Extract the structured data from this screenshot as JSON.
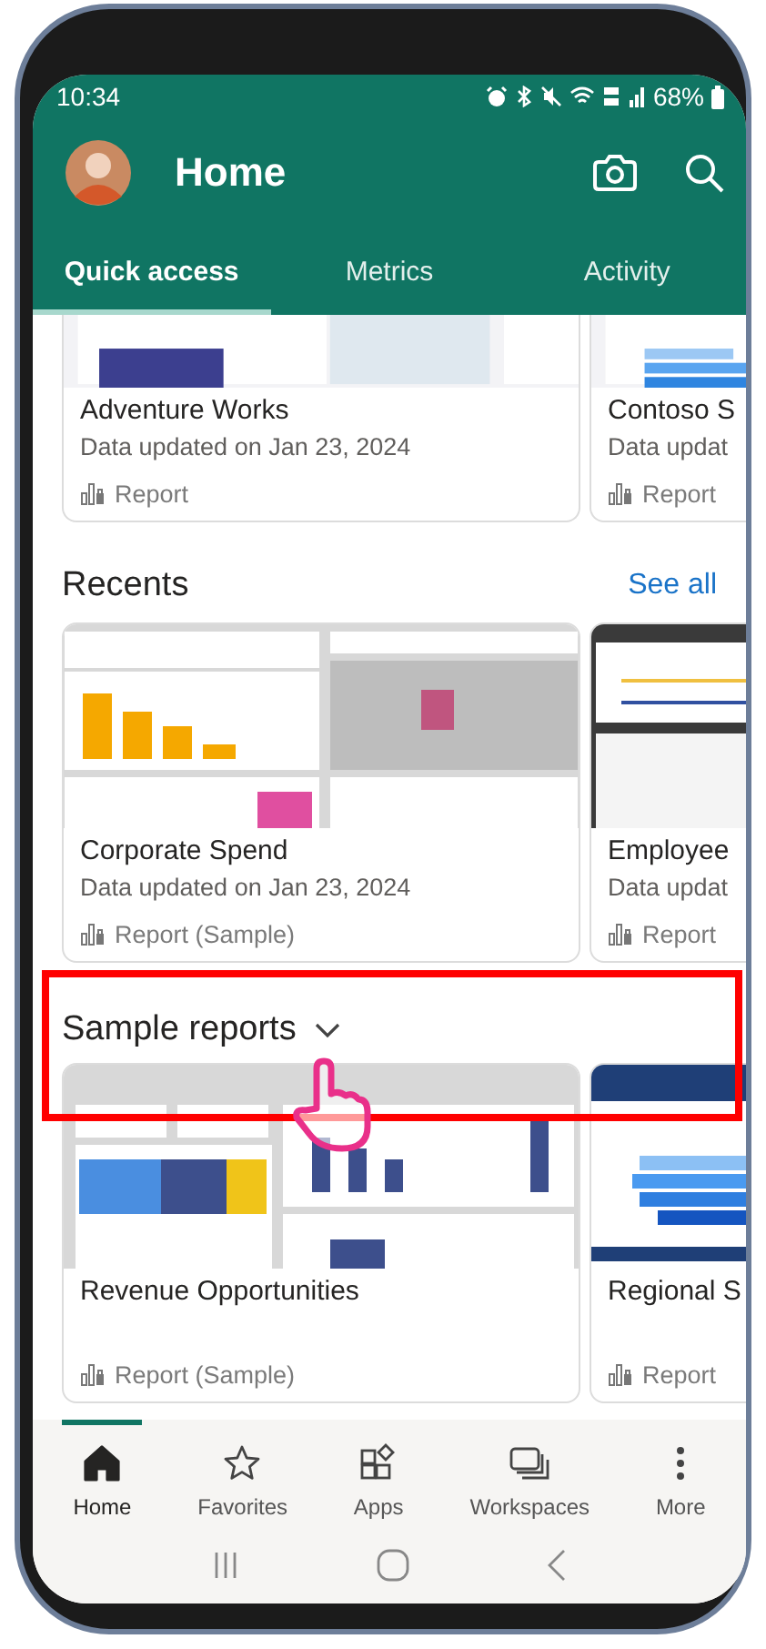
{
  "status_bar": {
    "time": "10:34",
    "battery": "68%"
  },
  "header": {
    "title": "Home"
  },
  "tabs": [
    {
      "label": "Quick access",
      "selected": true
    },
    {
      "label": "Metrics",
      "selected": false
    },
    {
      "label": "Activity",
      "selected": false
    }
  ],
  "quick_access": {
    "cards": [
      {
        "title": "Adventure Works",
        "updated": "Data updated on Jan 23, 2024",
        "type": "Report"
      },
      {
        "title": "Contoso S",
        "updated": "Data updat",
        "type": "Report"
      }
    ]
  },
  "recents": {
    "heading": "Recents",
    "link": "See all",
    "cards": [
      {
        "title": "Corporate Spend",
        "updated": "Data updated on Jan 23, 2024",
        "type": "Report (Sample)"
      },
      {
        "title": "Employee",
        "updated": "Data updat",
        "type": "Report"
      }
    ]
  },
  "sample_reports": {
    "heading": "Sample reports",
    "cards": [
      {
        "title": "Revenue Opportunities",
        "type": "Report (Sample)"
      },
      {
        "title": "Regional S",
        "type": "Report"
      }
    ]
  },
  "bottom_nav": [
    {
      "label": "Home",
      "selected": true
    },
    {
      "label": "Favorites",
      "selected": false
    },
    {
      "label": "Apps",
      "selected": false
    },
    {
      "label": "Workspaces",
      "selected": false
    },
    {
      "label": "More",
      "selected": false
    }
  ]
}
